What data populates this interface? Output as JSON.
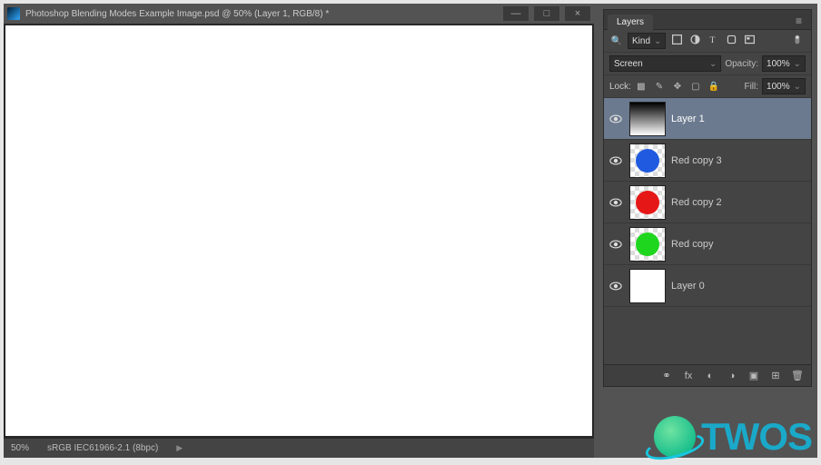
{
  "window": {
    "title": "Photoshop Blending Modes Example Image.psd @ 50% (Layer 1, RGB/8) *",
    "controls": {
      "min": "—",
      "max": "□",
      "close": "×"
    }
  },
  "statusbar": {
    "zoom": "50%",
    "profile": "sRGB IEC61966-2.1 (8bpc)"
  },
  "layers_panel": {
    "tab": "Layers",
    "filter": {
      "label": "Kind",
      "search": "🔍"
    },
    "blend_mode": "Screen",
    "opacity_label": "Opacity:",
    "opacity_value": "100%",
    "lock_label": "Lock:",
    "fill_label": "Fill:",
    "fill_value": "100%",
    "layers": [
      {
        "name": "Layer 1",
        "thumb": "gradient",
        "selected": true
      },
      {
        "name": "Red copy 3",
        "thumb": "blue",
        "selected": false
      },
      {
        "name": "Red copy 2",
        "thumb": "red",
        "selected": false
      },
      {
        "name": "Red copy",
        "thumb": "green",
        "selected": false
      },
      {
        "name": "Layer 0",
        "thumb": "white",
        "selected": false
      }
    ]
  },
  "watermark": "TWOS"
}
